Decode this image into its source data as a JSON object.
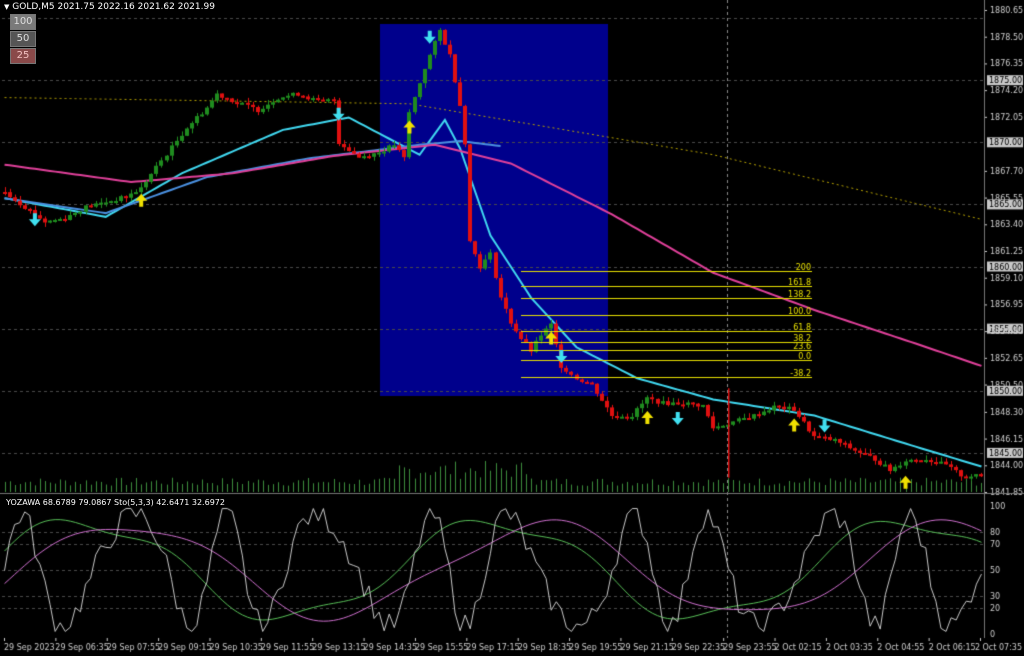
{
  "header": {
    "symbol_line": "GOLD,M5  2021.75 2022.16 2021.62 2021.99",
    "menu_icon": "triangle-down-icon"
  },
  "timeframe_buttons": [
    "100",
    "50",
    "25"
  ],
  "subwindow": {
    "title": "YOZAWA 68.6789 79.0867  Sto(5,3,3) 42.6471 32.6972"
  },
  "colors": {
    "bull": "#1f8c1f",
    "bear": "#e01010",
    "ma_cyan": "#40d8f0",
    "ma_blue": "#4a90e0",
    "ma_magenta": "#e0409a",
    "fib": "#e8e000",
    "selection": "#00008c",
    "arrow_up": "#f0e000",
    "arrow_down": "#40e0f0"
  },
  "chart_data": {
    "type": "candlestick",
    "symbol": "GOLD",
    "timeframe": "M5",
    "ylim": [
      1841.85,
      1880.65
    ],
    "y_ticks": [
      "1880.65",
      "1878.50",
      "1876.35",
      "1875.00",
      "1874.20",
      "1872.05",
      "1870.00",
      "1867.70",
      "1865.55",
      "1865.00",
      "1863.40",
      "1861.25",
      "1860.00",
      "1859.10",
      "1856.95",
      "1855.00",
      "1854.80",
      "1852.65",
      "1850.50",
      "1850.00",
      "1848.30",
      "1846.15",
      "1845.00",
      "1844.00",
      "1841.85"
    ],
    "price_levels_marked": [
      "1880.00",
      "1875.00",
      "1870.00",
      "1865.00",
      "1860.00",
      "1855.00",
      "1850.00",
      "1845.00"
    ],
    "x_ticks": [
      "29 Sep 2023",
      "29 Sep 06:35",
      "29 Sep 07:55",
      "29 Sep 09:15",
      "29 Sep 10:35",
      "29 Sep 11:55",
      "29 Sep 13:15",
      "29 Sep 14:35",
      "29 Sep 15:55",
      "29 Sep 17:15",
      "29 Sep 18:35",
      "29 Sep 19:55",
      "29 Sep 21:15",
      "29 Sep 22:35",
      "29 Sep 23:55",
      "2 Oct 02:15",
      "2 Oct 03:35",
      "2 Oct 04:55",
      "2 Oct 06:15",
      "2 Oct 07:35"
    ],
    "close_path": [
      [
        0,
        1866.0
      ],
      [
        4,
        1864.8
      ],
      [
        8,
        1863.6
      ],
      [
        12,
        1863.9
      ],
      [
        16,
        1864.8
      ],
      [
        20,
        1865.2
      ],
      [
        24,
        1865.6
      ],
      [
        27,
        1866.3
      ],
      [
        30,
        1868.0
      ],
      [
        33,
        1869.6
      ],
      [
        36,
        1871.2
      ],
      [
        40,
        1872.8
      ],
      [
        42,
        1873.9
      ],
      [
        46,
        1873.2
      ],
      [
        50,
        1872.6
      ],
      [
        54,
        1873.6
      ],
      [
        58,
        1873.9
      ],
      [
        62,
        1873.3
      ],
      [
        65,
        1873.4
      ],
      [
        66,
        1870.0
      ],
      [
        70,
        1868.8
      ],
      [
        74,
        1869.2
      ],
      [
        77,
        1869.8
      ],
      [
        79,
        1868.7
      ],
      [
        80,
        1872.4
      ],
      [
        83,
        1876.0
      ],
      [
        86,
        1879.0
      ],
      [
        88,
        1877.0
      ],
      [
        90,
        1873.0
      ],
      [
        91,
        1870.0
      ],
      [
        92,
        1862.0
      ],
      [
        94,
        1860.0
      ],
      [
        96,
        1861.0
      ],
      [
        98,
        1857.5
      ],
      [
        100,
        1855.5
      ],
      [
        102,
        1854.2
      ],
      [
        104,
        1853.2
      ],
      [
        106,
        1854.5
      ],
      [
        108,
        1855.3
      ],
      [
        110,
        1852.0
      ],
      [
        113,
        1851.0
      ],
      [
        116,
        1850.5
      ],
      [
        120,
        1848.0
      ],
      [
        124,
        1848.0
      ],
      [
        127,
        1849.4
      ],
      [
        130,
        1849.0
      ],
      [
        134,
        1849.0
      ],
      [
        138,
        1848.8
      ],
      [
        140,
        1847.0
      ],
      [
        144,
        1847.5
      ],
      [
        148,
        1848.0
      ],
      [
        152,
        1848.7
      ],
      [
        156,
        1848.5
      ],
      [
        160,
        1846.3
      ],
      [
        164,
        1846.0
      ],
      [
        168,
        1845.2
      ],
      [
        172,
        1844.5
      ],
      [
        175,
        1843.6
      ],
      [
        178,
        1844.4
      ],
      [
        182,
        1844.5
      ],
      [
        186,
        1844.0
      ],
      [
        189,
        1843.2
      ],
      [
        193,
        1843.1
      ]
    ],
    "moving_averages": [
      {
        "color": "cyan",
        "path": [
          [
            0,
            1865.5
          ],
          [
            20,
            1864.0
          ],
          [
            35,
            1867.5
          ],
          [
            55,
            1871.0
          ],
          [
            68,
            1872.0
          ],
          [
            82,
            1869.0
          ],
          [
            87,
            1871.8
          ],
          [
            90,
            1869.5
          ],
          [
            96,
            1862.5
          ],
          [
            104,
            1857.5
          ],
          [
            113,
            1853.5
          ],
          [
            125,
            1851.0
          ],
          [
            140,
            1849.3
          ],
          [
            160,
            1848.0
          ],
          [
            180,
            1845.5
          ],
          [
            193,
            1843.9
          ]
        ]
      },
      {
        "color": "blue",
        "path": [
          [
            0,
            1865.5
          ],
          [
            20,
            1864.3
          ],
          [
            40,
            1867.2
          ],
          [
            60,
            1868.7
          ],
          [
            82,
            1869.8
          ],
          [
            90,
            1870.1
          ],
          [
            98,
            1869.7
          ]
        ]
      },
      {
        "color": "magenta",
        "path": [
          [
            0,
            1868.2
          ],
          [
            25,
            1866.8
          ],
          [
            45,
            1867.5
          ],
          [
            65,
            1868.9
          ],
          [
            85,
            1869.8
          ],
          [
            100,
            1868.3
          ],
          [
            120,
            1864.2
          ],
          [
            140,
            1859.5
          ],
          [
            160,
            1856.5
          ],
          [
            180,
            1853.8
          ],
          [
            193,
            1852.0
          ]
        ]
      },
      {
        "color": "yellow-dotted",
        "path": [
          [
            0,
            1873.6
          ],
          [
            80,
            1873.1
          ],
          [
            140,
            1869.0
          ],
          [
            193,
            1863.8
          ]
        ]
      }
    ],
    "fibonacci_levels": [
      {
        "label": "200",
        "price": 1859.6
      },
      {
        "label": "161.8",
        "price": 1858.4
      },
      {
        "label": "138.2",
        "price": 1857.5
      },
      {
        "label": "100.0",
        "price": 1856.1
      },
      {
        "label": "61.8",
        "price": 1854.8
      },
      {
        "label": "38.2",
        "price": 1853.9
      },
      {
        "label": "23.6",
        "price": 1853.3
      },
      {
        "label": "0.0",
        "price": 1852.5
      },
      {
        "label": "-38.2",
        "price": 1851.1
      }
    ],
    "signals_up": [
      [
        27,
        1865.3
      ],
      [
        80,
        1871.2
      ],
      [
        108,
        1854.2
      ],
      [
        127,
        1847.8
      ],
      [
        156,
        1847.2
      ],
      [
        178,
        1842.6
      ]
    ],
    "signals_down": [
      [
        6,
        1863.8
      ],
      [
        66,
        1872.3
      ],
      [
        84,
        1878.5
      ],
      [
        110,
        1852.8
      ],
      [
        133,
        1847.8
      ],
      [
        162,
        1847.2
      ]
    ],
    "oscillator": {
      "ylim": [
        0,
        100
      ],
      "levels": [
        "100",
        "80",
        "70",
        "50",
        "30",
        "20",
        "0"
      ]
    }
  }
}
